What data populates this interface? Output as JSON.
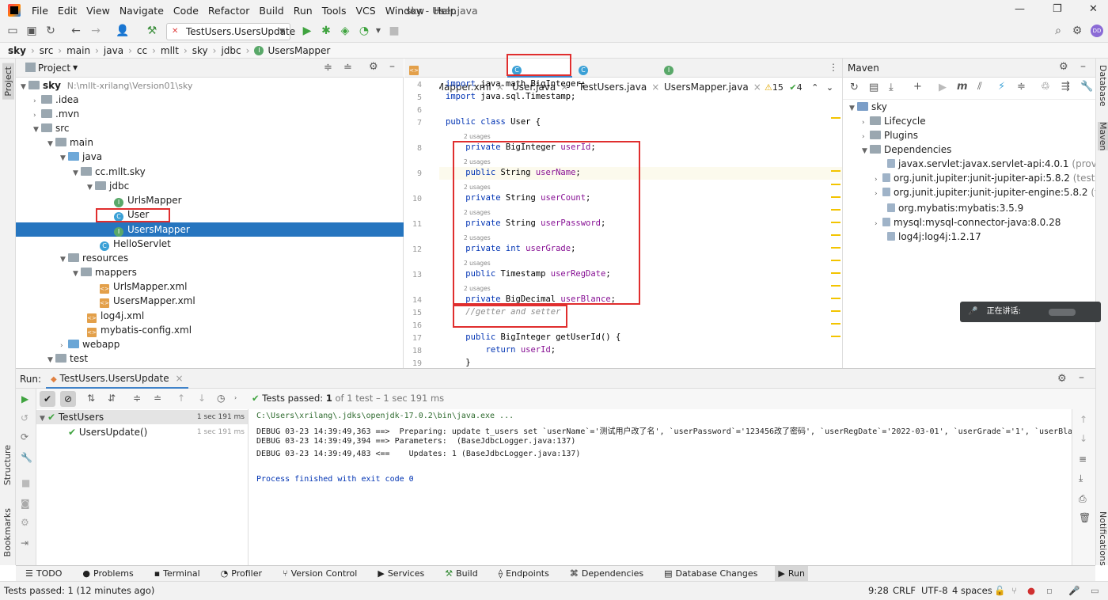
{
  "menu": {
    "items": [
      "File",
      "Edit",
      "View",
      "Navigate",
      "Code",
      "Refactor",
      "Build",
      "Run",
      "Tools",
      "VCS",
      "Window",
      "Help"
    ],
    "window_title": "sky - User.java"
  },
  "toolbar": {
    "run_config": "TestUsers.UsersUpdate"
  },
  "breadcrumbs": [
    "sky",
    "src",
    "main",
    "java",
    "cc",
    "mllt",
    "sky",
    "jdbc",
    "UsersMapper"
  ],
  "left_stripe": {
    "project": "Project",
    "structure": "Structure",
    "bookmarks": "Bookmarks"
  },
  "project": {
    "title": "Project",
    "root_name": "sky",
    "root_path": "N:\\mllt-xrilang\\Version01\\sky",
    "tree": [
      {
        "label": ".idea"
      },
      {
        "label": ".mvn"
      },
      {
        "label": "src"
      },
      {
        "label": "main"
      },
      {
        "label": "java"
      },
      {
        "label": "cc.mllt.sky"
      },
      {
        "label": "jdbc"
      },
      {
        "label": "UrlsMapper"
      },
      {
        "label": "User"
      },
      {
        "label": "UsersMapper"
      },
      {
        "label": "HelloServlet"
      },
      {
        "label": "resources"
      },
      {
        "label": "mappers"
      },
      {
        "label": "UrlsMapper.xml"
      },
      {
        "label": "UsersMapper.xml"
      },
      {
        "label": "log4j.xml"
      },
      {
        "label": "mybatis-config.xml"
      },
      {
        "label": "webapp"
      },
      {
        "label": "test"
      }
    ]
  },
  "editor": {
    "tabs": [
      "UsersMapper.xml",
      "User.java",
      "TestUsers.java",
      "UsersMapper.java"
    ],
    "warnings": "15",
    "checks": "4",
    "usages": "2 usages",
    "lines": [
      {
        "n": "4",
        "text": "import java.math.BigInteger;"
      },
      {
        "n": "5",
        "text": "import java.sql.Timestamp;"
      },
      {
        "n": "6",
        "text": ""
      },
      {
        "n": "7",
        "text": "public class User {"
      },
      {
        "n": "8",
        "text": "    private BigInteger userId;"
      },
      {
        "n": "9",
        "text": "    public String userName;"
      },
      {
        "n": "10",
        "text": "    private String userCount;"
      },
      {
        "n": "11",
        "text": "    private String userPassword;"
      },
      {
        "n": "12",
        "text": "    private int userGrade;"
      },
      {
        "n": "13",
        "text": "    public Timestamp userRegDate;"
      },
      {
        "n": "14",
        "text": "    private BigDecimal userBlance;"
      },
      {
        "n": "15",
        "text": "    //getter and setter"
      },
      {
        "n": "16",
        "text": ""
      },
      {
        "n": "17",
        "text": "    public BigInteger getUserId() {"
      },
      {
        "n": "18",
        "text": "        return userId;"
      },
      {
        "n": "19",
        "text": "    }"
      }
    ]
  },
  "maven": {
    "title": "Maven",
    "root": "sky",
    "nodes": [
      "Lifecycle",
      "Plugins",
      "Dependencies"
    ],
    "deps": [
      {
        "name": "javax.servlet:javax.servlet-api:4.0.1",
        "scope": "(provided)"
      },
      {
        "name": "org.junit.jupiter:junit-jupiter-api:5.8.2",
        "scope": "(test)"
      },
      {
        "name": "org.junit.jupiter:junit-jupiter-engine:5.8.2",
        "scope": "(test)"
      },
      {
        "name": "org.mybatis:mybatis:3.5.9",
        "scope": ""
      },
      {
        "name": "mysql:mysql-connector-java:8.0.28",
        "scope": ""
      },
      {
        "name": "log4j:log4j:1.2.17",
        "scope": ""
      }
    ]
  },
  "right_stripe": {
    "database": "Database",
    "maven": "Maven",
    "notifications": "Notifications"
  },
  "popup": {
    "text": "正在讲话:"
  },
  "run": {
    "label": "Run:",
    "tab": "TestUsers.UsersUpdate",
    "status_prefix": "Tests passed:",
    "status_count": "1",
    "status_rest": "of 1 test – 1 sec 191 ms",
    "tree": [
      {
        "name": "TestUsers",
        "time": "1 sec 191 ms"
      },
      {
        "name": "UsersUpdate()",
        "time": "1 sec 191 ms"
      }
    ],
    "console": [
      "C:\\Users\\xrilang\\.jdks\\openjdk-17.0.2\\bin\\java.exe ...",
      "DEBUG 03-23 14:39:49,363 ==>  Preparing: update t_users set `userName`='测试用户改了名', `userPassword`='123456改了密码', `userRegDate`='2022-03-01', `userGrade`='1', `userBlance`='",
      "DEBUG 03-23 14:39:49,394 ==> Parameters:  (BaseJdbcLogger.java:137)",
      "DEBUG 03-23 14:39:49,483 <==    Updates: 1 (BaseJdbcLogger.java:137)",
      "",
      "Process finished with exit code 0"
    ]
  },
  "tool_tabs": [
    "TODO",
    "Problems",
    "Terminal",
    "Profiler",
    "Version Control",
    "Services",
    "Build",
    "Endpoints",
    "Dependencies",
    "Database Changes",
    "Run"
  ],
  "status": {
    "message": "Tests passed: 1 (12 minutes ago)",
    "position": "9:28",
    "line_sep": "CRLF",
    "encoding": "UTF-8",
    "indent": "4 spaces"
  }
}
